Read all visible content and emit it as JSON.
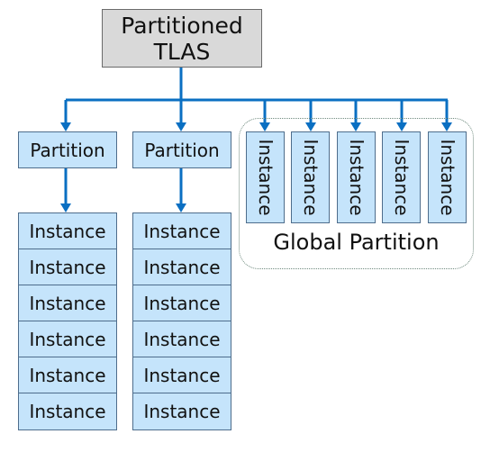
{
  "root": {
    "label_line1": "Partitioned",
    "label_line2": "TLAS"
  },
  "partitions": [
    {
      "label": "Partition",
      "instances": [
        "Instance",
        "Instance",
        "Instance",
        "Instance",
        "Instance",
        "Instance"
      ]
    },
    {
      "label": "Partition",
      "instances": [
        "Instance",
        "Instance",
        "Instance",
        "Instance",
        "Instance",
        "Instance"
      ]
    }
  ],
  "global_partition": {
    "label": "Global Partition",
    "instances": [
      "Instance",
      "Instance",
      "Instance",
      "Instance",
      "Instance"
    ]
  },
  "colors": {
    "arrow": "#0a6fc2",
    "node_fill": "#c5e4fb",
    "root_fill": "#d9d9d9"
  }
}
